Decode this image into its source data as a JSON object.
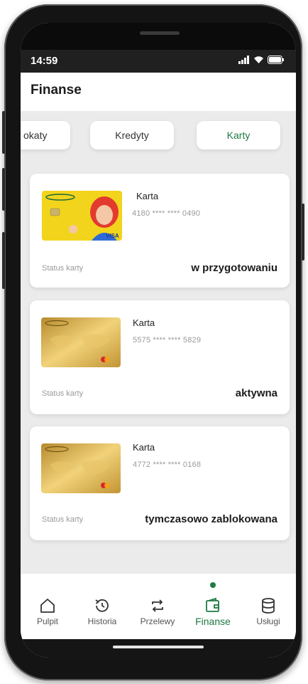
{
  "status_bar": {
    "time": "14:59"
  },
  "header": {
    "title": "Finanse"
  },
  "tabs": [
    {
      "label": "Lokaty",
      "visible_label": "okaty"
    },
    {
      "label": "Kredyty"
    },
    {
      "label": "Karty",
      "active": true
    }
  ],
  "cards": [
    {
      "name": "Karta",
      "number": "4180 **** **** 0490",
      "status_label": "Status karty",
      "status": "w przygotowaniu",
      "card_design": "yellow-visa",
      "card_network": "VISA"
    },
    {
      "name": "Karta",
      "number": "5575 **** **** 5829",
      "status_label": "Status karty",
      "status": "aktywna",
      "card_design": "gold-mastercard"
    },
    {
      "name": "Karta",
      "number": "4772 **** **** 0168",
      "status_label": "Status karty",
      "status": "tymczasowo zablokowana",
      "card_design": "gold-mastercard"
    }
  ],
  "bottom_nav": {
    "items": [
      {
        "label": "Pulpit",
        "icon": "home-icon"
      },
      {
        "label": "Historia",
        "icon": "history-icon"
      },
      {
        "label": "Przelewy",
        "icon": "transfer-icon"
      },
      {
        "label": "Finanse",
        "icon": "wallet-icon",
        "active": true
      },
      {
        "label": "Usługi",
        "icon": "database-icon"
      }
    ]
  },
  "colors": {
    "accent": "#1f7a43",
    "background": "#ebebeb",
    "card": "#ffffff"
  }
}
